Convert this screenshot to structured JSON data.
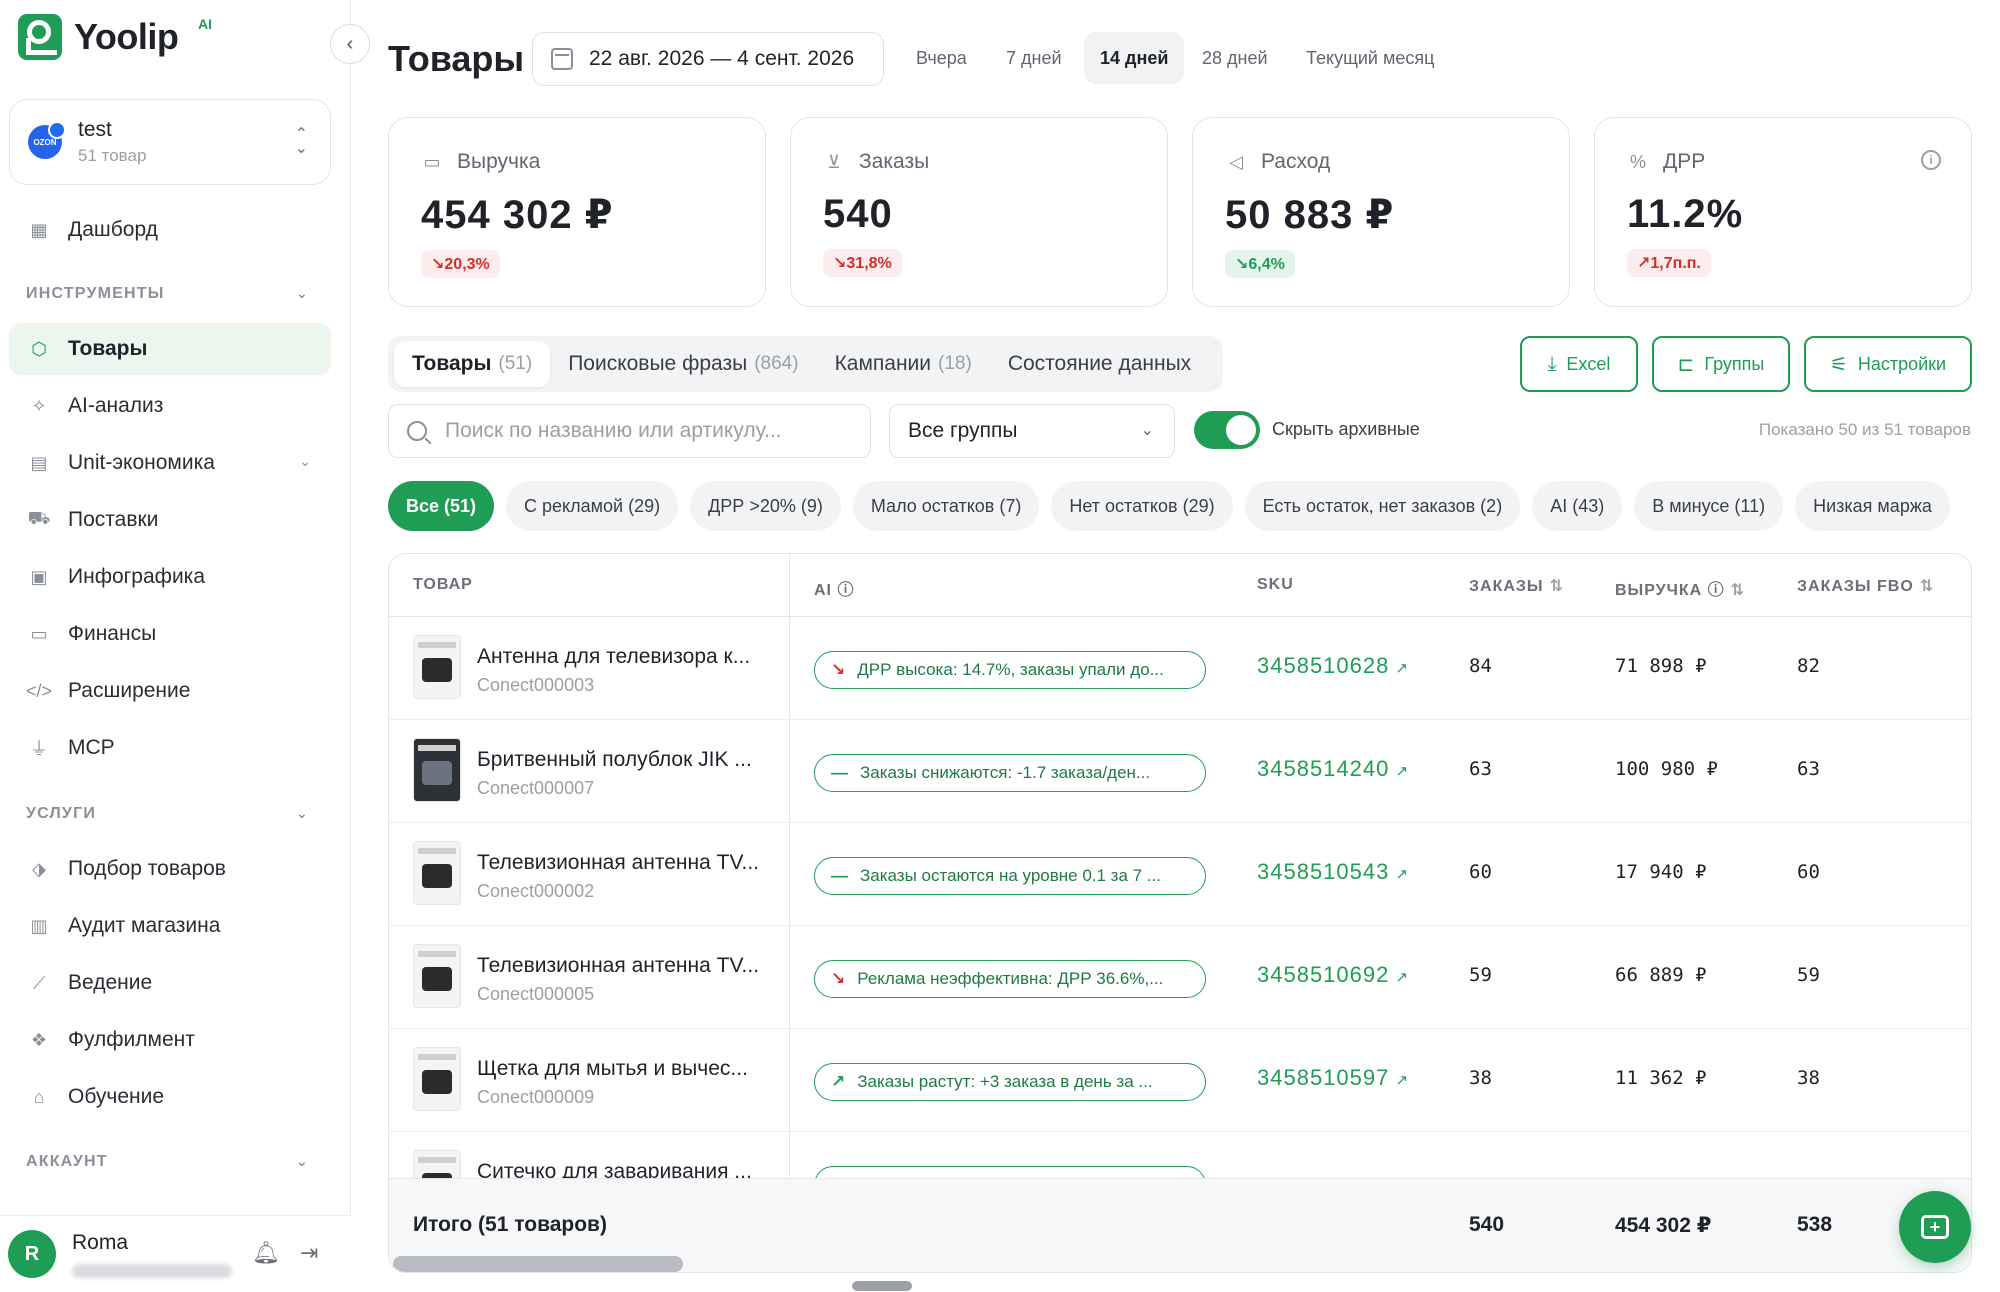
{
  "brand": {
    "name": "Yoolip",
    "ai_tag": "AI",
    "accent": "#1f9d55"
  },
  "shop": {
    "name": "test",
    "sub": "51 товар",
    "avatar_text": "OZON"
  },
  "nav": {
    "dashboard": "Дашборд",
    "section_tools": "ИНСТРУМЕНТЫ",
    "tools": [
      "Товары",
      "AI-анализ",
      "Unit-экономика",
      "Поставки",
      "Инфографика",
      "Финансы",
      "Расширение",
      "MCP"
    ],
    "section_services": "УСЛУГИ",
    "services": [
      "Подбор товаров",
      "Аудит магазина",
      "Ведение",
      "Фулфилмент",
      "Обучение"
    ],
    "section_account": "АККАУНТ"
  },
  "user": {
    "initial": "R",
    "name": "Roma"
  },
  "header": {
    "title": "Товары",
    "date_range": "22 авг. 2026 — 4 сент. 2026",
    "periods": [
      "Вчера",
      "7 дней",
      "14 дней",
      "28 дней",
      "Текущий месяц"
    ],
    "active_period": "14 дней"
  },
  "kpis": [
    {
      "label": "Выручка",
      "value": "454 302 ₽",
      "delta": "↘20,3%",
      "tone": "red"
    },
    {
      "label": "Заказы",
      "value": "540",
      "delta": "↘31,8%",
      "tone": "red"
    },
    {
      "label": "Расход",
      "value": "50 883 ₽",
      "delta": "↘6,4%",
      "tone": "green"
    },
    {
      "label": "ДРР",
      "value": "11.2%",
      "delta": "↗1,7п.п.",
      "tone": "red"
    }
  ],
  "tabs": [
    {
      "label": "Товары",
      "count": "(51)"
    },
    {
      "label": "Поисковые фразы",
      "count": "(864)"
    },
    {
      "label": "Кампании",
      "count": "(18)"
    },
    {
      "label": "Состояние данных",
      "count": ""
    }
  ],
  "actions": {
    "excel": "Excel",
    "groups": "Группы",
    "settings": "Настройки"
  },
  "filters": {
    "search_placeholder": "Поиск по названию или артикулу...",
    "group_select": "Все группы",
    "hide_archived": "Скрыть архивные",
    "shown_count": "Показано 50 из 51 товаров"
  },
  "chips": [
    "Все (51)",
    "С рекламой (29)",
    "ДРР >20% (9)",
    "Мало остатков (7)",
    "Нет остатков (29)",
    "Есть остаток, нет заказов (2)",
    "AI (43)",
    "В минусе (11)",
    "Низкая маржа"
  ],
  "table": {
    "headers": {
      "product": "ТОВАР",
      "ai": "AI",
      "sku": "SKU",
      "orders": "ЗАКАЗЫ",
      "revenue": "ВЫРУЧКА",
      "orders_fbo": "ЗАКАЗЫ FBO"
    },
    "rows": [
      {
        "name": "Антенна для телевизора к...",
        "article": "Conect000003",
        "ai": "ДРР высока: 14.7%, заказы упали до...",
        "trend": "down",
        "sku": "3458510628",
        "orders": "84",
        "revenue": "71 898 ₽",
        "fbo": "82"
      },
      {
        "name": "Бритвенный полублок JIK ...",
        "article": "Conect000007",
        "ai": "Заказы снижаются: -1.7 заказа/ден...",
        "trend": "flat",
        "sku": "3458514240",
        "orders": "63",
        "revenue": "100 980 ₽",
        "fbo": "63"
      },
      {
        "name": "Телевизионная антенна TV...",
        "article": "Conect000002",
        "ai": "Заказы остаются на уровне 0.1 за 7 ...",
        "trend": "flat",
        "sku": "3458510543",
        "orders": "60",
        "revenue": "17 940 ₽",
        "fbo": "60"
      },
      {
        "name": "Телевизионная антенна TV...",
        "article": "Conect000005",
        "ai": "Реклама неэффективна: ДРР 36.6%,...",
        "trend": "down",
        "sku": "3458510692",
        "orders": "59",
        "revenue": "66 889 ₽",
        "fbo": "59"
      },
      {
        "name": "Щетка для мытья и вычес...",
        "article": "Conect000009",
        "ai": "Заказы растут: +3 заказа в день за ...",
        "trend": "up",
        "sku": "3458510597",
        "orders": "38",
        "revenue": "11 362 ₽",
        "fbo": "38"
      },
      {
        "name": "Ситечко для заваривания ...",
        "article": "",
        "ai": "",
        "trend": "up",
        "sku": "",
        "orders": "",
        "revenue": "",
        "fbo": ""
      }
    ],
    "footer": {
      "label": "Итого (51 товаров)",
      "orders": "540",
      "revenue": "454 302 ₽",
      "fbo": "538"
    }
  }
}
